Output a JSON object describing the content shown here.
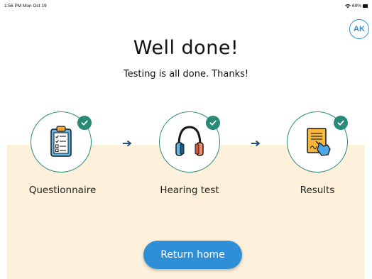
{
  "status_bar": {
    "time_date": "1:56 PM  Mon Oct 19",
    "battery": "69%"
  },
  "user": {
    "initials": "AK"
  },
  "heading": {
    "title": "Well done!",
    "subtitle": "Testing is all done. Thanks!"
  },
  "steps": [
    {
      "label": "Questionnaire",
      "icon": "clipboard-icon",
      "completed": true
    },
    {
      "label": "Hearing test",
      "icon": "headphones-icon",
      "completed": true
    },
    {
      "label": "Results",
      "icon": "signed-document-icon",
      "completed": true
    }
  ],
  "actions": {
    "return_home": "Return home"
  },
  "colors": {
    "accent": "#2f8fd6",
    "check": "#2a8a78",
    "band": "#fdf1dc",
    "arrow": "#1f4f7a"
  }
}
